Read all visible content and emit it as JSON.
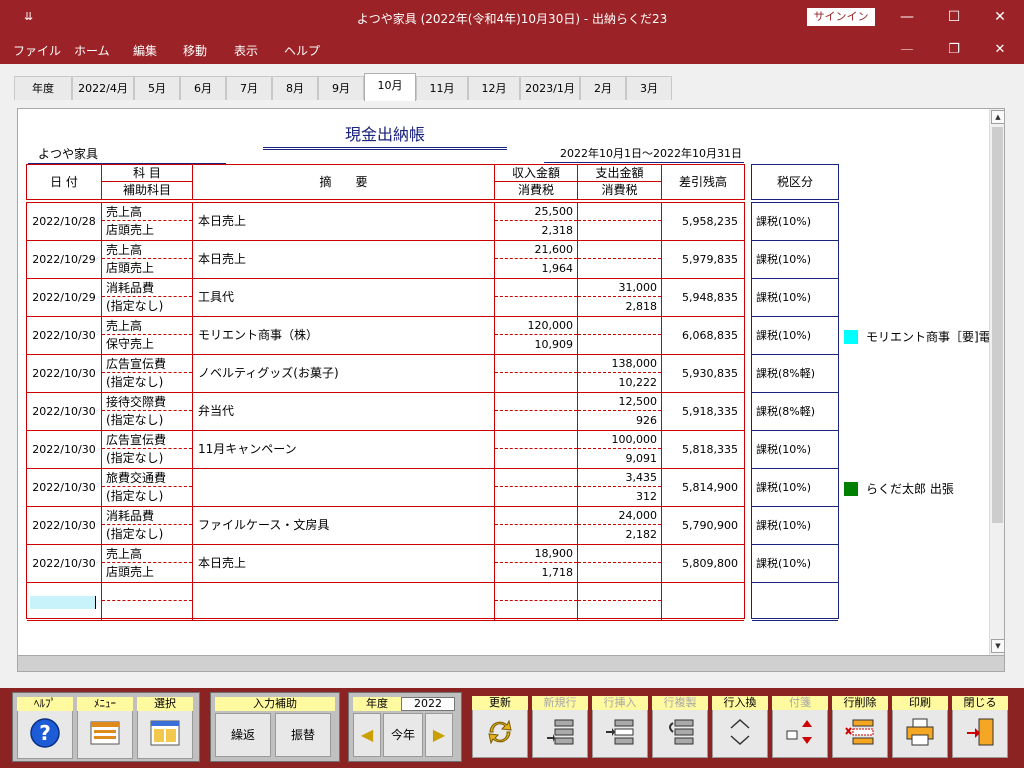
{
  "window": {
    "title": "よつや家具 (2022年(令和4年)10月30日)  -  出納らくだ23",
    "sysmenu_icon": "pin-icon",
    "signin": "サインイン"
  },
  "menu": [
    "ファイル",
    "ホーム",
    "編集",
    "移動",
    "表示",
    "ヘルプ"
  ],
  "tabs": [
    {
      "label": "年度",
      "active": false
    },
    {
      "label": "2022/4月",
      "active": false
    },
    {
      "label": "5月",
      "active": false
    },
    {
      "label": "6月",
      "active": false
    },
    {
      "label": "7月",
      "active": false
    },
    {
      "label": "8月",
      "active": false
    },
    {
      "label": "9月",
      "active": false
    },
    {
      "label": "10月",
      "active": true
    },
    {
      "label": "11月",
      "active": false
    },
    {
      "label": "12月",
      "active": false
    },
    {
      "label": "2023/1月",
      "active": false
    },
    {
      "label": "2月",
      "active": false
    },
    {
      "label": "3月",
      "active": false
    }
  ],
  "sheet": {
    "title": "現金出納帳",
    "company": "よつや家具",
    "period": "2022年10月1日～2022年10月31日"
  },
  "headers": {
    "date": "日 付",
    "account": "科 目",
    "sub_account": "補助科目",
    "memo": "摘　　要",
    "income": "収入金額",
    "income_tax": "消費税",
    "expense": "支出金額",
    "expense_tax": "消費税",
    "balance": "差引残高",
    "tax_class": "税区分"
  },
  "rows": [
    {
      "date": "2022/10/28",
      "account": "売上高",
      "sub": "店頭売上",
      "memo": "本日売上",
      "income": "25,500",
      "income_tax": "2,318",
      "expense": "",
      "expense_tax": "",
      "balance": "5,958,235",
      "tax": "課税(10%)"
    },
    {
      "date": "2022/10/29",
      "account": "売上高",
      "sub": "店頭売上",
      "memo": "本日売上",
      "income": "21,600",
      "income_tax": "1,964",
      "expense": "",
      "expense_tax": "",
      "balance": "5,979,835",
      "tax": "課税(10%)"
    },
    {
      "date": "2022/10/29",
      "account": "消耗品費",
      "sub": "(指定なし)",
      "memo": "工具代",
      "income": "",
      "income_tax": "",
      "expense": "31,000",
      "expense_tax": "2,818",
      "balance": "5,948,835",
      "tax": "課税(10%)"
    },
    {
      "date": "2022/10/30",
      "account": "売上高",
      "sub": "保守売上",
      "memo": "モリエント商事（株）",
      "income": "120,000",
      "income_tax": "10,909",
      "expense": "",
      "expense_tax": "",
      "balance": "6,068,835",
      "tax": "課税(10%)"
    },
    {
      "date": "2022/10/30",
      "account": "広告宣伝費",
      "sub": "(指定なし)",
      "memo": "ノベルティグッズ(お菓子)",
      "income": "",
      "income_tax": "",
      "expense": "138,000",
      "expense_tax": "10,222",
      "balance": "5,930,835",
      "tax": "課税(8%軽)"
    },
    {
      "date": "2022/10/30",
      "account": "接待交際費",
      "sub": "(指定なし)",
      "memo": "弁当代",
      "income": "",
      "income_tax": "",
      "expense": "12,500",
      "expense_tax": "926",
      "balance": "5,918,335",
      "tax": "課税(8%軽)"
    },
    {
      "date": "2022/10/30",
      "account": "広告宣伝費",
      "sub": "(指定なし)",
      "memo": "11月キャンペーン",
      "income": "",
      "income_tax": "",
      "expense": "100,000",
      "expense_tax": "9,091",
      "balance": "5,818,335",
      "tax": "課税(10%)"
    },
    {
      "date": "2022/10/30",
      "account": "旅費交通費",
      "sub": "(指定なし)",
      "memo": "",
      "income": "",
      "income_tax": "",
      "expense": "3,435",
      "expense_tax": "312",
      "balance": "5,814,900",
      "tax": "課税(10%)"
    },
    {
      "date": "2022/10/30",
      "account": "消耗品費",
      "sub": "(指定なし)",
      "memo": "ファイルケース・文房具",
      "income": "",
      "income_tax": "",
      "expense": "24,000",
      "expense_tax": "2,182",
      "balance": "5,790,900",
      "tax": "課税(10%)"
    },
    {
      "date": "2022/10/30",
      "account": "売上高",
      "sub": "店頭売上",
      "memo": "本日売上",
      "income": "18,900",
      "income_tax": "1,718",
      "expense": "",
      "expense_tax": "",
      "balance": "5,809,800",
      "tax": "課税(10%)"
    }
  ],
  "notes": [
    {
      "row": 3,
      "text": "モリエント商事［要]電",
      "color": "#00ffff"
    },
    {
      "row": 7,
      "text": "らくだ太郎  出張",
      "color": "#008000"
    }
  ],
  "toolbar": {
    "help": "ﾍﾙﾌﾟ",
    "menu": "ﾒﾆｭｰ",
    "select": "選択",
    "input_assist": "入力補助",
    "carry": "繰返",
    "transfer": "振替",
    "year_label": "年度",
    "year_value": "2022",
    "this_year": "今年",
    "update": "更新",
    "new_row": "新規行",
    "insert_row": "行挿入",
    "copy_row": "行複製",
    "swap_row": "行入換",
    "sticky": "付箋",
    "delete_row": "行削除",
    "print": "印刷",
    "close": "閉じる"
  },
  "colors": {
    "accent": "#9b2226",
    "grid": "#cc0000",
    "navy": "#1a237e"
  }
}
